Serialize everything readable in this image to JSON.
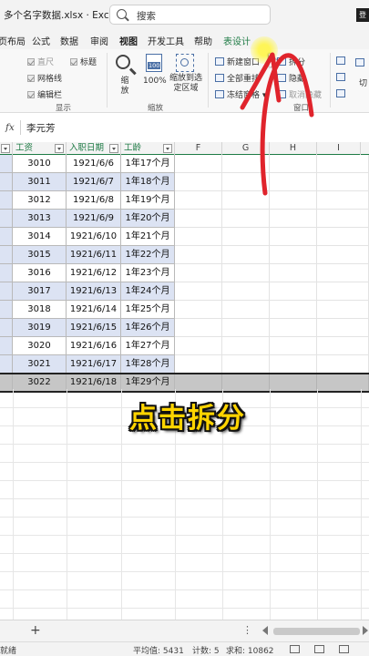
{
  "titlebar": {
    "doc_title": "多个名字数据.xlsx  ·  Excel",
    "search_placeholder": "搜索",
    "signin": "登"
  },
  "tabs": [
    "页布局",
    "公式",
    "数据",
    "审阅",
    "视图",
    "开发工具",
    "帮助",
    "表设计"
  ],
  "active_tab": "视图",
  "ribbon": {
    "show_group": {
      "items": [
        "直尺",
        "网格线",
        "编辑栏",
        "标题"
      ],
      "label": "显示"
    },
    "zoom_group": {
      "zoom": "缩放",
      "hundred": "100%",
      "hundred_icon": "100",
      "zoom_to_selection": "缩放到选定区域",
      "label": "缩放"
    },
    "window_group": {
      "new_window": "新建窗口",
      "arrange_all": "全部重排",
      "freeze_panes": "冻结窗格",
      "split": "拆分",
      "hide": "隐藏",
      "unhide": "取消隐藏",
      "switch": "切",
      "label": "窗口"
    }
  },
  "formula_bar": {
    "fx": "fx",
    "value": "李元芳"
  },
  "columns": {
    "c1": "工资",
    "c2": "入职日期",
    "c3": "工龄",
    "F": "F",
    "G": "G",
    "H": "H",
    "I": "I"
  },
  "rows": [
    {
      "salary": "3010",
      "date": "1921/6/6",
      "tenure": "1年17个月"
    },
    {
      "salary": "3011",
      "date": "1921/6/7",
      "tenure": "1年18个月"
    },
    {
      "salary": "3012",
      "date": "1921/6/8",
      "tenure": "1年19个月"
    },
    {
      "salary": "3013",
      "date": "1921/6/9",
      "tenure": "1年20个月"
    },
    {
      "salary": "3014",
      "date": "1921/6/10",
      "tenure": "1年21个月"
    },
    {
      "salary": "3015",
      "date": "1921/6/11",
      "tenure": "1年22个月"
    },
    {
      "salary": "3016",
      "date": "1921/6/12",
      "tenure": "1年23个月"
    },
    {
      "salary": "3017",
      "date": "1921/6/13",
      "tenure": "1年24个月"
    },
    {
      "salary": "3018",
      "date": "1921/6/14",
      "tenure": "1年25个月"
    },
    {
      "salary": "3019",
      "date": "1921/6/15",
      "tenure": "1年26个月"
    },
    {
      "salary": "3020",
      "date": "1921/6/16",
      "tenure": "1年27个月"
    },
    {
      "salary": "3021",
      "date": "1921/6/17",
      "tenure": "1年28个月"
    },
    {
      "salary": "3022",
      "date": "1921/6/18",
      "tenure": "1年29个月"
    }
  ],
  "caption": "点击拆分",
  "sheetbar": {
    "add": "+",
    "more": "⋮"
  },
  "statusbar": {
    "ready": "就绪",
    "average": "平均值: 5431",
    "count": "计数: 5",
    "sum": "求和: 10862"
  },
  "colors": {
    "accent_green": "#1e7b45",
    "band_blue": "#dce3f3",
    "arrow_red": "#e0242c",
    "caption_yellow": "#ffd400"
  }
}
